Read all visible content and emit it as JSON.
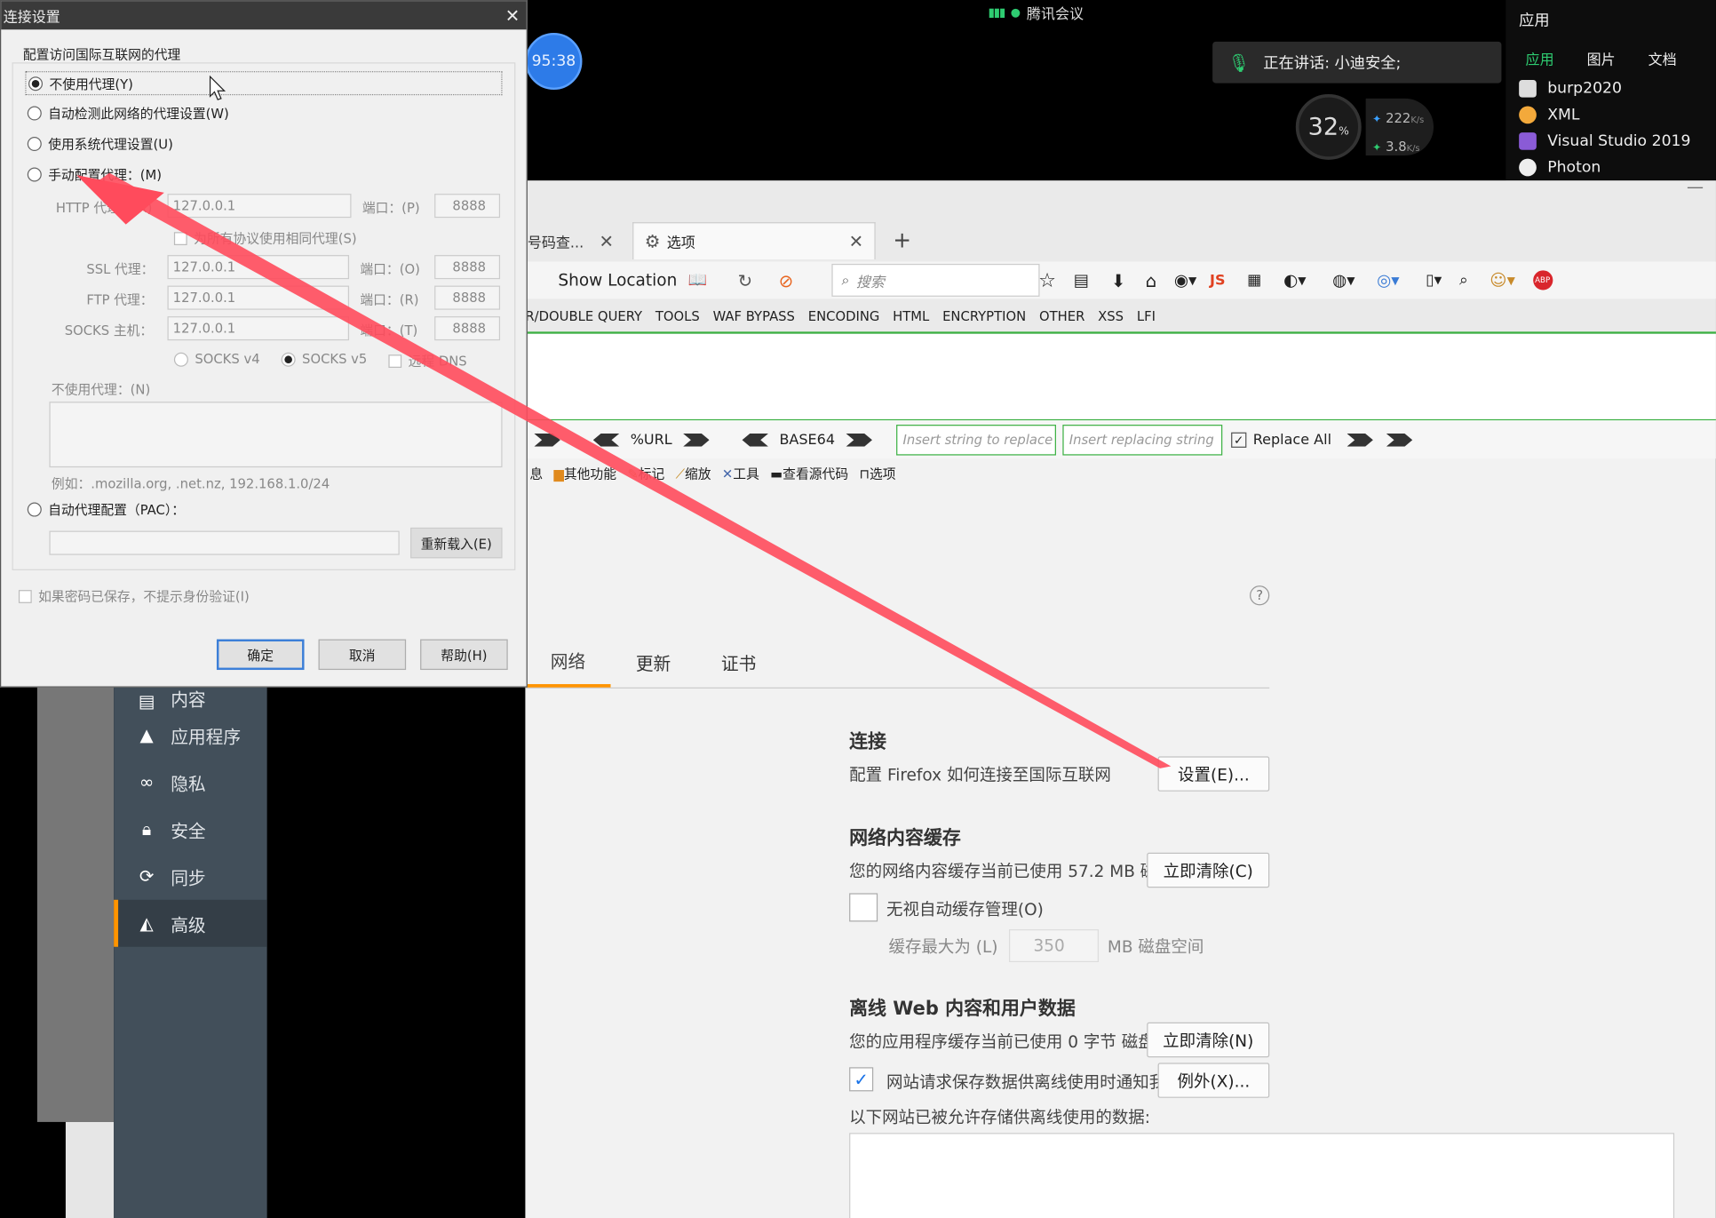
{
  "meeting": {
    "app_name": "腾讯会议",
    "timer": "95:38",
    "speaking": "正在讲话: 小迪安全;",
    "cpu_percent": "32",
    "cpu_unit": "%",
    "net_up": "222",
    "net_down": "3.8",
    "net_unit": "K/s"
  },
  "app_panel": {
    "title": "应用",
    "tabs": [
      "应用",
      "图片",
      "文档"
    ],
    "items": [
      "burp2020",
      "XML",
      "Visual Studio 2019",
      "Photon"
    ]
  },
  "firefox": {
    "tab1_label": "号码查...",
    "tab2_label": "选项",
    "show_location": "Show Location",
    "search_placeholder": "搜索",
    "menu": [
      "R/DOUBLE QUERY",
      "TOOLS",
      "WAF BYPASS",
      "ENCODING",
      "HTML",
      "ENCRYPTION",
      "OTHER",
      "XSS",
      "LFI"
    ],
    "hackbar": {
      "url_label": "%URL",
      "base64_label": "BASE64",
      "insert_replace_placeholder": "Insert string to replace",
      "insert_replacing_placeholder": "Insert replacing string",
      "replace_all": "Replace All"
    },
    "toolbar2": [
      "息",
      "其他功能",
      "标记",
      "缩放",
      "工具",
      "查看源代码",
      "选项"
    ],
    "settings_tabs": [
      "网络",
      "更新",
      "证书"
    ],
    "connection": {
      "title": "连接",
      "desc": "配置 Firefox 如何连接至国际互联网",
      "button": "设置(E)..."
    },
    "cache": {
      "title": "网络内容缓存",
      "desc": "您的网络内容缓存当前已使用 57.2 MB 磁盘空间",
      "clear_button": "立即清除(C)",
      "override_label": "无视自动缓存管理(O)",
      "max_label": "缓存最大为 (L)",
      "max_value": "350",
      "max_unit": "MB 磁盘空间"
    },
    "offline": {
      "title": "离线 Web 内容和用户数据",
      "desc": "您的应用程序缓存当前已使用 0 字节 磁盘空间",
      "clear_button": "立即清除(N)",
      "notify_label": "网站请求保存数据供离线使用时通知我(T)",
      "exceptions_button": "例外(X)...",
      "allowed_label": "以下网站已被允许存储供离线使用的数据:"
    }
  },
  "sidebar": {
    "items": [
      "内容",
      "应用程序",
      "隐私",
      "安全",
      "同步",
      "高级"
    ],
    "active": "高级"
  },
  "dialog": {
    "title": "连接设置",
    "group_label": "配置访问国际互联网的代理",
    "options": {
      "no_proxy": "不使用代理(Y)",
      "auto_detect": "自动检测此网络的代理设置(W)",
      "system": "使用系统代理设置(U)",
      "manual": "手动配置代理：(M)",
      "pac": "自动代理配置（PAC）："
    },
    "http_label": "HTTP 代理：(X)",
    "http_value": "127.0.0.1",
    "port_label": "端口：(P)",
    "port_value": "8888",
    "same_proxy": "为所有协议使用相同代理(S)",
    "ssl_label": "SSL 代理：",
    "ssl_value": "127.0.0.1",
    "ssl_port_label": "端口：(O)",
    "ftp_label": "FTP 代理：",
    "ftp_value": "127.0.0.1",
    "ftp_port_label": "端口：(R)",
    "socks_label": "SOCKS 主机：",
    "socks_value": "127.0.0.1",
    "socks_port_label": "端口：(T)",
    "socks_v4": "SOCKS v4",
    "socks_v5": "SOCKS v5",
    "remote_dns": "远程 DNS",
    "no_proxy_for": "不使用代理：(N)",
    "example": "例如：.mozilla.org, .net.nz, 192.168.1.0/24",
    "reload": "重新载入(E)",
    "no_prompt": "如果密码已保存，不提示身份验证(I)",
    "ok": "确定",
    "cancel": "取消",
    "help": "帮助(H)"
  },
  "colors": {
    "accent_orange": "#ff9400",
    "annotation_red": "#ff4b5c",
    "hackbar_green": "#3cb043",
    "meeting_blue": "#2d7be8"
  }
}
